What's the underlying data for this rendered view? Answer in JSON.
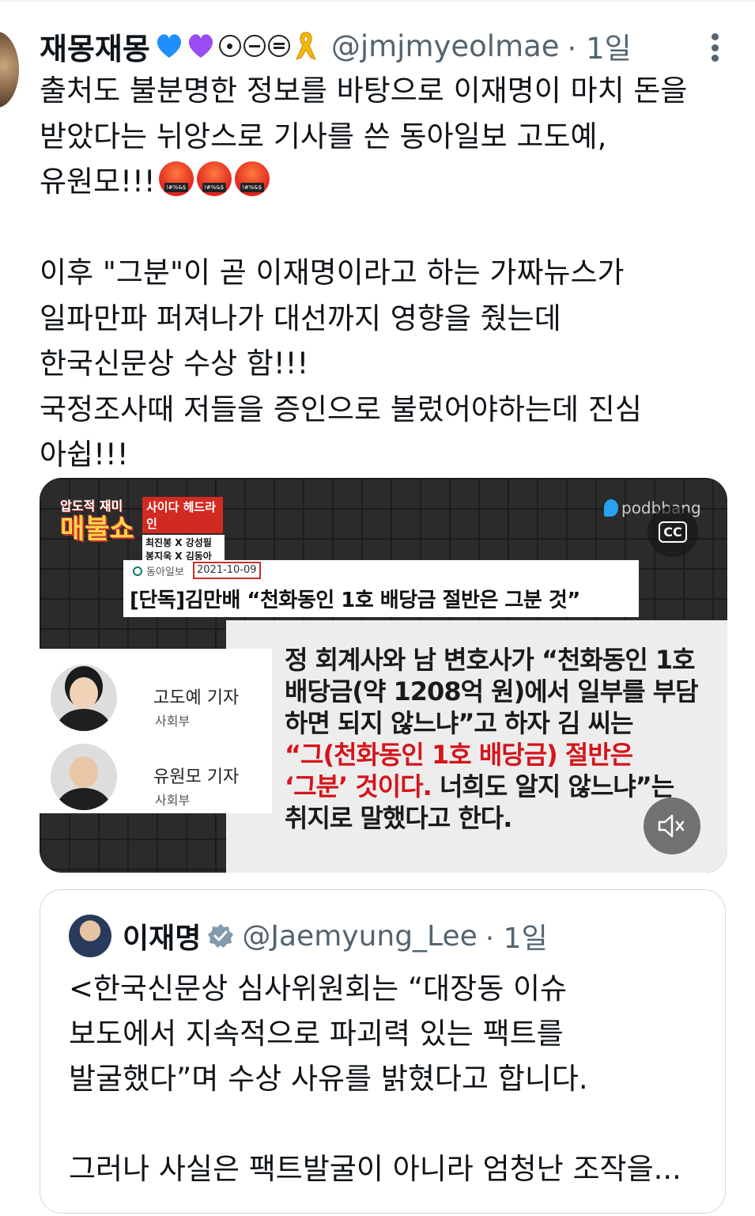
{
  "tweet": {
    "display_name": "재몽재몽",
    "handle": "@jmjmyeolmae",
    "time": "· 1일",
    "name_icons": [
      "blue-heart-icon",
      "purple-heart-icon",
      "circle-dot-icon",
      "circle-minus-icon",
      "circle-equal-icon",
      "yellow-ribbon-icon"
    ],
    "lines": [
      "출처도 불분명한 정보를 바탕으로 이재명이 마치 돈을",
      "받았다는 뉘앙스로 기사를 쓴 동아일보 고도예,",
      "유원모!!!",
      "",
      "이후 \"그분\"이 곧 이재명이라고 하는 가짜뉴스가",
      "일파만파 퍼져나가 대선까지 영향을 줬는데",
      "한국신문상 수상 함!!!",
      "국정조사때 저들을 증인으로 불렀어야하는데 진심",
      "아쉽!!!"
    ],
    "angry_emoji_count": 3
  },
  "media": {
    "show_logo_top": "압도적 재미",
    "show_logo_main": "매불쇼",
    "headline_label": "사이다 헤드라인",
    "headline_names": [
      "최진봉 X 강성필",
      "봉지욱 X 김동아"
    ],
    "podbbang": "podbbang",
    "cc_label": "CC",
    "article_source": "동아일보",
    "article_date": "2021-10-09",
    "article_title": "[단독]김만배 “천화동인 1호 배당금 절반은 그분 것”",
    "reporters": [
      {
        "name": "고도예 기자",
        "dept": "사회부"
      },
      {
        "name": "유원모 기자",
        "dept": "사회부"
      }
    ],
    "quote_lines": [
      "정 회계사와 남 변호사가 “천화동인 1호",
      "배당금(약 1208억 원)에서 일부를 부담",
      "하면 되지 않느냐”고 하자 김 씨는"
    ],
    "quote_red_1": "“그(천화동인 1호 배당금) 절반은",
    "quote_red_2": "‘그분’ 것이다.",
    "quote_after_red": " 너희도 알지 않느냐”는",
    "quote_last": "취지로 말했다고 한다."
  },
  "quoted_tweet": {
    "display_name": "이재명",
    "handle": "@Jaemyung_Lee",
    "time": "· 1일",
    "lines": [
      "<한국신문상 심사위원회는 “대장동 이슈",
      "보도에서 지속적으로 파괴력 있는 팩트를",
      "발굴했다”며 수상 사유를 밝혔다고 합니다.",
      "",
      "그러나 사실은 팩트발굴이 아니라 엄청난 조작을..."
    ]
  },
  "colors": {
    "text": "#0f1419",
    "secondary": "#536471",
    "accent_red": "#d4141b",
    "verified": "#829aab"
  }
}
